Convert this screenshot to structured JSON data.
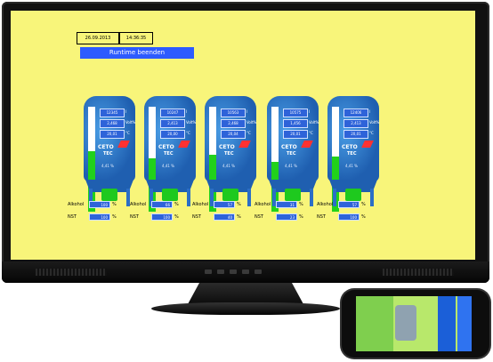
{
  "header": {
    "date": "26.09.2013",
    "time": "14:36:35",
    "banner": "Runtime beenden"
  },
  "tanks": [
    {
      "level": 0.85,
      "v1": "12345",
      "u1": "l",
      "v2": "2,468",
      "u2": "Volt%",
      "v3": "20,01",
      "u3": "°C",
      "logo1": "CETO",
      "logo2": "TEC",
      "sub": "4,41 %"
    },
    {
      "level": 0.75,
      "v1": "10247",
      "u1": "l",
      "v2": "2,413",
      "u2": "Volt%",
      "v3": "20,00",
      "u3": "°C",
      "logo1": "CETO",
      "logo2": "TEC",
      "sub": "4,41 %"
    },
    {
      "level": 0.8,
      "v1": "10563",
      "u1": "l",
      "v2": "2,468",
      "u2": "Volt%",
      "v3": "20,04",
      "u3": "°C",
      "logo1": "CETO",
      "logo2": "TEC",
      "sub": "4,41 %"
    },
    {
      "level": 0.7,
      "v1": "10575",
      "u1": "l",
      "v2": "1,456",
      "u2": "Volt%",
      "v3": "20,01",
      "u3": "°C",
      "logo1": "CETO",
      "logo2": "TEC",
      "sub": "4,41 %"
    },
    {
      "level": 0.78,
      "v1": "12406",
      "u1": "l",
      "v2": "2,413",
      "u2": "Volt%",
      "v3": "20,01",
      "u3": "°C",
      "logo1": "CETO",
      "logo2": "TEC",
      "sub": "4,41 %"
    }
  ],
  "params": [
    {
      "alk_label": "Alkohol",
      "alk": "100",
      "alk_unit": "%",
      "nst_label": "NST",
      "nst": "100",
      "nst_unit": "%"
    },
    {
      "alk_label": "Alkohol",
      "alk": "66",
      "alk_unit": "%",
      "nst_label": "NST",
      "nst": "100",
      "nst_unit": "%"
    },
    {
      "alk_label": "Alkohol",
      "alk": "57",
      "alk_unit": "%",
      "nst_label": "NST",
      "nst": "40",
      "nst_unit": "%"
    },
    {
      "alk_label": "Alkohol",
      "alk": "31",
      "alk_unit": "%",
      "nst_label": "NST",
      "nst": "23",
      "nst_unit": "%"
    },
    {
      "alk_label": "Alkohol",
      "alk": "57",
      "alk_unit": "%",
      "nst_label": "NST",
      "nst": "100",
      "nst_unit": "%"
    }
  ],
  "colors": {
    "screen_bg": "#f8f57a",
    "tank_blue": "#1f5fb0",
    "level_green": "#21d11b",
    "banner_blue": "#2d5bff"
  }
}
